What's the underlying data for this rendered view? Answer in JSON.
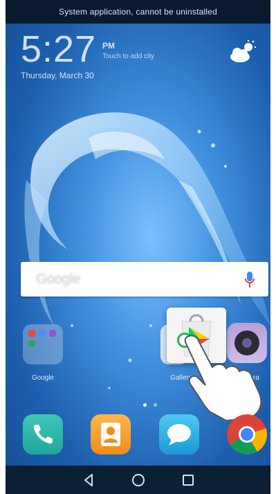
{
  "status_bar": {
    "message": "System application, cannot be uninstalled"
  },
  "clock_widget": {
    "time": "5:27",
    "ampm": "PM",
    "subtitle": "Touch to add city",
    "date": "Thursday, March 30"
  },
  "weather_widget": {
    "icon": "partly-cloudy-icon"
  },
  "search_bar": {
    "logo_text": "Google",
    "mic_icon": "microphone-icon"
  },
  "apps": {
    "folder_label": "Google",
    "gallery_label": "Gallery",
    "camera_label": "Camera",
    "dragged_app_icon": "play-store-icon"
  },
  "home_pages": {
    "count": 2,
    "current": 1
  },
  "dock": [
    "phone-icon",
    "contacts-icon",
    "messages-icon",
    "chrome-icon"
  ],
  "navigation": [
    "back-icon",
    "home-icon",
    "recents-icon"
  ],
  "colors": {
    "accent_green": "#1db954",
    "wallpaper_blue": "#3f8fde"
  }
}
